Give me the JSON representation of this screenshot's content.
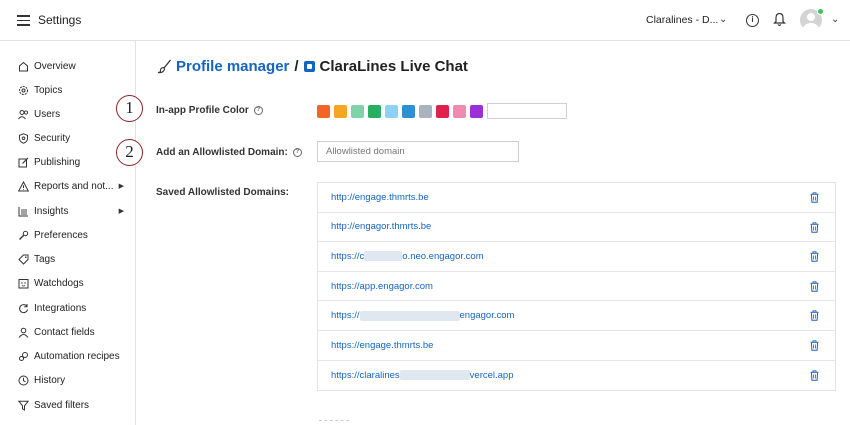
{
  "app": {
    "title": "Settings"
  },
  "header": {
    "account_label": "Claralines - D..."
  },
  "sidebar": {
    "items": [
      {
        "label": "Overview",
        "icon": "home-icon"
      },
      {
        "label": "Topics",
        "icon": "topics-gear-icon"
      },
      {
        "label": "Users",
        "icon": "users-icon"
      },
      {
        "label": "Security",
        "icon": "shield-icon"
      },
      {
        "label": "Publishing",
        "icon": "edit-icon"
      },
      {
        "label": "Reports and not...",
        "icon": "warning-icon",
        "submenu": true
      },
      {
        "label": "Insights",
        "icon": "chart-icon",
        "submenu": true
      },
      {
        "label": "Preferences",
        "icon": "wrench-icon"
      },
      {
        "label": "Tags",
        "icon": "tag-icon"
      },
      {
        "label": "Watchdogs",
        "icon": "watchdog-icon"
      },
      {
        "label": "Integrations",
        "icon": "sync-icon"
      },
      {
        "label": "Contact fields",
        "icon": "person-icon"
      },
      {
        "label": "Automation recipes",
        "icon": "automation-icon"
      },
      {
        "label": "History",
        "icon": "clock-icon"
      },
      {
        "label": "Saved filters",
        "icon": "filter-icon"
      }
    ]
  },
  "main": {
    "breadcrumb": {
      "parent": "Profile manager",
      "separator": "/",
      "current": "ClaraLines Live Chat"
    },
    "callouts": [
      "1",
      "2"
    ],
    "profile_color": {
      "label": "In-app Profile Color",
      "swatches": [
        "#f26522",
        "#f5a623",
        "#7ed3a8",
        "#27ae60",
        "#8fd0f5",
        "#2d8fd5",
        "#a9b3bd",
        "#e0204d",
        "#f08bb0",
        "#9b30d9"
      ]
    },
    "allowlist": {
      "label": "Add an Allowlisted Domain:",
      "placeholder": "Allowlisted domain",
      "saved_label": "Saved Allowlisted Domains:",
      "domains": [
        {
          "pre": "http://engage.thmrts.be",
          "blur": 0,
          "post": ""
        },
        {
          "pre": "http://engagor.thmrts.be",
          "blur": 0,
          "post": ""
        },
        {
          "pre": "https://c",
          "blur": 38,
          "post": "o.neo.engagor.com"
        },
        {
          "pre": "https://app.engagor.com",
          "blur": 0,
          "post": ""
        },
        {
          "pre": "https://",
          "blur": 100,
          "post": "engagor.com"
        },
        {
          "pre": "https://engage.thmrts.be",
          "blur": 0,
          "post": ""
        },
        {
          "pre": "https://claralines",
          "blur": 70,
          "post": "vercel.app"
        }
      ]
    }
  }
}
